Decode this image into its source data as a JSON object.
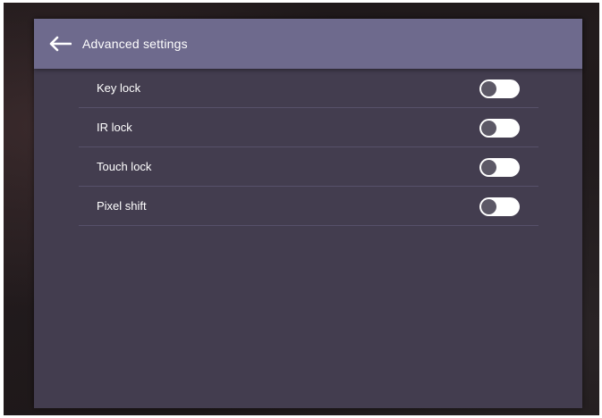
{
  "header": {
    "title": "Advanced settings",
    "back_icon": "arrow-left-icon"
  },
  "settings": {
    "items": [
      {
        "label": "Key lock",
        "enabled": false
      },
      {
        "label": "IR lock",
        "enabled": false
      },
      {
        "label": "Touch lock",
        "enabled": false
      },
      {
        "label": "Pixel shift",
        "enabled": false
      }
    ]
  },
  "colors": {
    "header_bg": "#6e6a8d",
    "panel_bg": "#433d4f",
    "toggle_track": "#ffffff",
    "toggle_knob": "#5c5866"
  }
}
